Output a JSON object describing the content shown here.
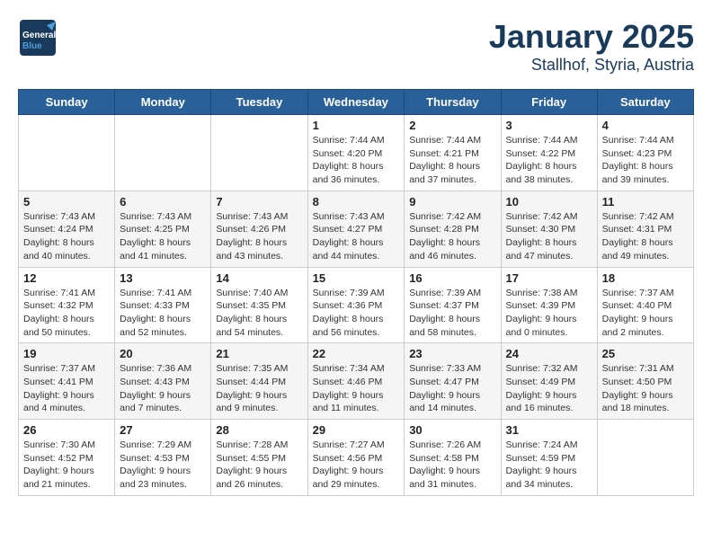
{
  "header": {
    "logo_general": "General",
    "logo_blue": "Blue",
    "month": "January 2025",
    "location": "Stallhof, Styria, Austria"
  },
  "weekdays": [
    "Sunday",
    "Monday",
    "Tuesday",
    "Wednesday",
    "Thursday",
    "Friday",
    "Saturday"
  ],
  "weeks": [
    [
      {
        "day": "",
        "info": ""
      },
      {
        "day": "",
        "info": ""
      },
      {
        "day": "",
        "info": ""
      },
      {
        "day": "1",
        "info": "Sunrise: 7:44 AM\nSunset: 4:20 PM\nDaylight: 8 hours\nand 36 minutes."
      },
      {
        "day": "2",
        "info": "Sunrise: 7:44 AM\nSunset: 4:21 PM\nDaylight: 8 hours\nand 37 minutes."
      },
      {
        "day": "3",
        "info": "Sunrise: 7:44 AM\nSunset: 4:22 PM\nDaylight: 8 hours\nand 38 minutes."
      },
      {
        "day": "4",
        "info": "Sunrise: 7:44 AM\nSunset: 4:23 PM\nDaylight: 8 hours\nand 39 minutes."
      }
    ],
    [
      {
        "day": "5",
        "info": "Sunrise: 7:43 AM\nSunset: 4:24 PM\nDaylight: 8 hours\nand 40 minutes."
      },
      {
        "day": "6",
        "info": "Sunrise: 7:43 AM\nSunset: 4:25 PM\nDaylight: 8 hours\nand 41 minutes."
      },
      {
        "day": "7",
        "info": "Sunrise: 7:43 AM\nSunset: 4:26 PM\nDaylight: 8 hours\nand 43 minutes."
      },
      {
        "day": "8",
        "info": "Sunrise: 7:43 AM\nSunset: 4:27 PM\nDaylight: 8 hours\nand 44 minutes."
      },
      {
        "day": "9",
        "info": "Sunrise: 7:42 AM\nSunset: 4:28 PM\nDaylight: 8 hours\nand 46 minutes."
      },
      {
        "day": "10",
        "info": "Sunrise: 7:42 AM\nSunset: 4:30 PM\nDaylight: 8 hours\nand 47 minutes."
      },
      {
        "day": "11",
        "info": "Sunrise: 7:42 AM\nSunset: 4:31 PM\nDaylight: 8 hours\nand 49 minutes."
      }
    ],
    [
      {
        "day": "12",
        "info": "Sunrise: 7:41 AM\nSunset: 4:32 PM\nDaylight: 8 hours\nand 50 minutes."
      },
      {
        "day": "13",
        "info": "Sunrise: 7:41 AM\nSunset: 4:33 PM\nDaylight: 8 hours\nand 52 minutes."
      },
      {
        "day": "14",
        "info": "Sunrise: 7:40 AM\nSunset: 4:35 PM\nDaylight: 8 hours\nand 54 minutes."
      },
      {
        "day": "15",
        "info": "Sunrise: 7:39 AM\nSunset: 4:36 PM\nDaylight: 8 hours\nand 56 minutes."
      },
      {
        "day": "16",
        "info": "Sunrise: 7:39 AM\nSunset: 4:37 PM\nDaylight: 8 hours\nand 58 minutes."
      },
      {
        "day": "17",
        "info": "Sunrise: 7:38 AM\nSunset: 4:39 PM\nDaylight: 9 hours\nand 0 minutes."
      },
      {
        "day": "18",
        "info": "Sunrise: 7:37 AM\nSunset: 4:40 PM\nDaylight: 9 hours\nand 2 minutes."
      }
    ],
    [
      {
        "day": "19",
        "info": "Sunrise: 7:37 AM\nSunset: 4:41 PM\nDaylight: 9 hours\nand 4 minutes."
      },
      {
        "day": "20",
        "info": "Sunrise: 7:36 AM\nSunset: 4:43 PM\nDaylight: 9 hours\nand 7 minutes."
      },
      {
        "day": "21",
        "info": "Sunrise: 7:35 AM\nSunset: 4:44 PM\nDaylight: 9 hours\nand 9 minutes."
      },
      {
        "day": "22",
        "info": "Sunrise: 7:34 AM\nSunset: 4:46 PM\nDaylight: 9 hours\nand 11 minutes."
      },
      {
        "day": "23",
        "info": "Sunrise: 7:33 AM\nSunset: 4:47 PM\nDaylight: 9 hours\nand 14 minutes."
      },
      {
        "day": "24",
        "info": "Sunrise: 7:32 AM\nSunset: 4:49 PM\nDaylight: 9 hours\nand 16 minutes."
      },
      {
        "day": "25",
        "info": "Sunrise: 7:31 AM\nSunset: 4:50 PM\nDaylight: 9 hours\nand 18 minutes."
      }
    ],
    [
      {
        "day": "26",
        "info": "Sunrise: 7:30 AM\nSunset: 4:52 PM\nDaylight: 9 hours\nand 21 minutes."
      },
      {
        "day": "27",
        "info": "Sunrise: 7:29 AM\nSunset: 4:53 PM\nDaylight: 9 hours\nand 23 minutes."
      },
      {
        "day": "28",
        "info": "Sunrise: 7:28 AM\nSunset: 4:55 PM\nDaylight: 9 hours\nand 26 minutes."
      },
      {
        "day": "29",
        "info": "Sunrise: 7:27 AM\nSunset: 4:56 PM\nDaylight: 9 hours\nand 29 minutes."
      },
      {
        "day": "30",
        "info": "Sunrise: 7:26 AM\nSunset: 4:58 PM\nDaylight: 9 hours\nand 31 minutes."
      },
      {
        "day": "31",
        "info": "Sunrise: 7:24 AM\nSunset: 4:59 PM\nDaylight: 9 hours\nand 34 minutes."
      },
      {
        "day": "",
        "info": ""
      }
    ]
  ]
}
